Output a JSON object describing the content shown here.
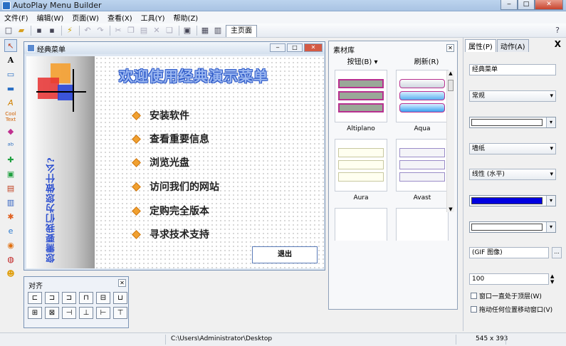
{
  "app": {
    "title": "AutoPlay Menu Builder"
  },
  "menubar": [
    "文件(F)",
    "编辑(W)",
    "页面(W)",
    "查看(X)",
    "工具(Y)",
    "帮助(Z)"
  ],
  "toolbar": {
    "page_tab": "主页面"
  },
  "toolbox": [
    "pointer-tool",
    "text-tool",
    "button-tool",
    "image-tool",
    "font-tool",
    "cooltext-tool",
    "shape-tool",
    "list-tool",
    "flash-tool",
    "install-tool",
    "media-tool",
    "document-tool",
    "effect-tool",
    "ie-tool",
    "player-tool",
    "chat-tool",
    "help-tool"
  ],
  "menu_window": {
    "title": "经典菜单",
    "heading": "欢迎使用经典演示菜单",
    "side_text": "您需要我们为您做什么?",
    "items": [
      "安装软件",
      "查看重要信息",
      "浏览光盘",
      "访问我们的网站",
      "定购完全版本",
      "寻求技术支持"
    ],
    "exit_button": "退出"
  },
  "align_panel": {
    "title": "对齐"
  },
  "library": {
    "title": "素材库",
    "tab_buttons": "按钮(B)",
    "tab_refresh": "刷新(R)",
    "items": [
      {
        "label": "Altiplano"
      },
      {
        "label": "Aqua"
      },
      {
        "label": "Aura"
      },
      {
        "label": "Avast"
      }
    ]
  },
  "props": {
    "tab_properties": "属性(P)",
    "tab_actions": "动作(A)",
    "close": "X",
    "name_field": "经典菜单",
    "style_drop": "常规",
    "wallpaper_drop": "墙纸",
    "gradient_drop": "线性 (水平)",
    "image_field": "(GIF 图像)",
    "opacity_value": "100",
    "browse": "...",
    "check_topmost": "窗口一直处于顶层(W)",
    "check_drag": "拖动任何位置移动窗口(V)",
    "colors": {
      "primary": "#0000e0",
      "secondary": "#ffffff"
    }
  },
  "status": {
    "path": "C:\\Users\\Administrator\\Desktop",
    "size": "545 x 393"
  }
}
